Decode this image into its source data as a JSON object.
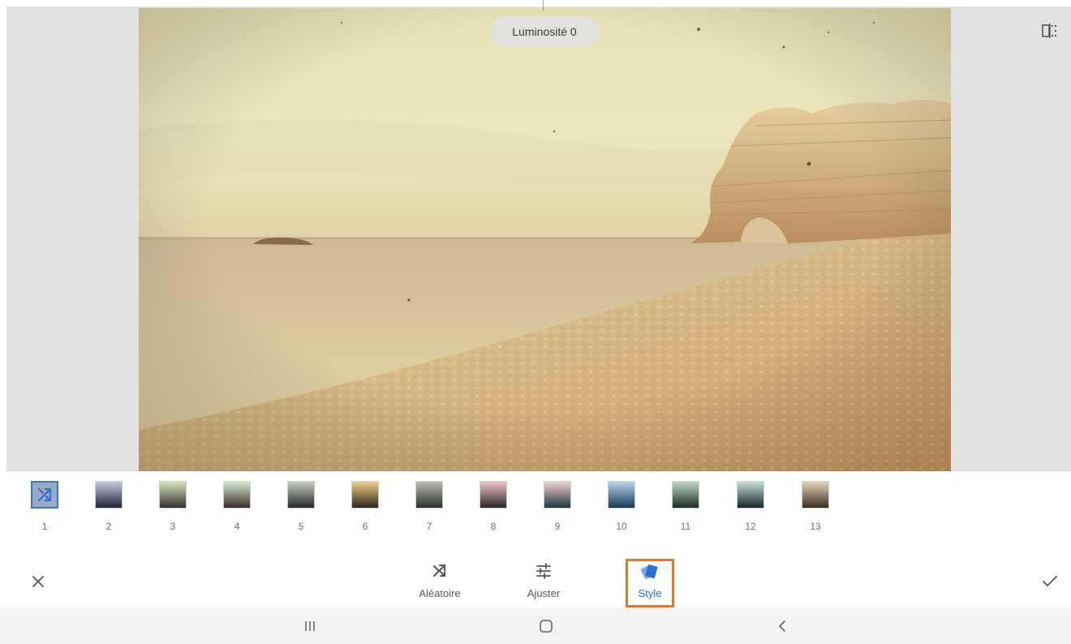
{
  "overlay": {
    "adjustment_label": "Luminosité 0"
  },
  "icons": {
    "compare": "compare-icon",
    "shuffle": "shuffle-icon",
    "adjust": "sliders-icon",
    "style": "style-cards-icon",
    "cancel": "close-icon",
    "apply": "check-icon",
    "recents": "recent-apps-icon",
    "home": "home-icon",
    "back": "back-icon"
  },
  "styles": {
    "selected": "1",
    "items": [
      {
        "label": "1",
        "top": "#8f9fbf",
        "bottom": "#8f9fbf"
      },
      {
        "label": "2",
        "top": "#c6c8de",
        "bottom": "#1d2638"
      },
      {
        "label": "3",
        "top": "#d3e8b4",
        "bottom": "#3a2c34"
      },
      {
        "label": "4",
        "top": "#d4ecd3",
        "bottom": "#3c2a25"
      },
      {
        "label": "5",
        "top": "#c6cbbf",
        "bottom": "#252b2a"
      },
      {
        "label": "6",
        "top": "#f0cf86",
        "bottom": "#2f281f"
      },
      {
        "label": "7",
        "top": "#bbbcb1",
        "bottom": "#2b2f2e"
      },
      {
        "label": "8",
        "top": "#f1c4c4",
        "bottom": "#2a2428"
      },
      {
        "label": "9",
        "top": "#f1d4cf",
        "bottom": "#1e3440"
      },
      {
        "label": "10",
        "top": "#b6d5f0",
        "bottom": "#143a55"
      },
      {
        "label": "11",
        "top": "#bfd7c5",
        "bottom": "#1b2d24"
      },
      {
        "label": "12",
        "top": "#c5dfd9",
        "bottom": "#1a2630"
      },
      {
        "label": "13",
        "top": "#e8d5b9",
        "bottom": "#3a2c1f"
      }
    ]
  },
  "tools": {
    "random_label": "Aléatoire",
    "adjust_label": "Ajuster",
    "style_label": "Style"
  },
  "colors": {
    "accent": "#2f6fd0",
    "highlight": "#e8782a"
  }
}
